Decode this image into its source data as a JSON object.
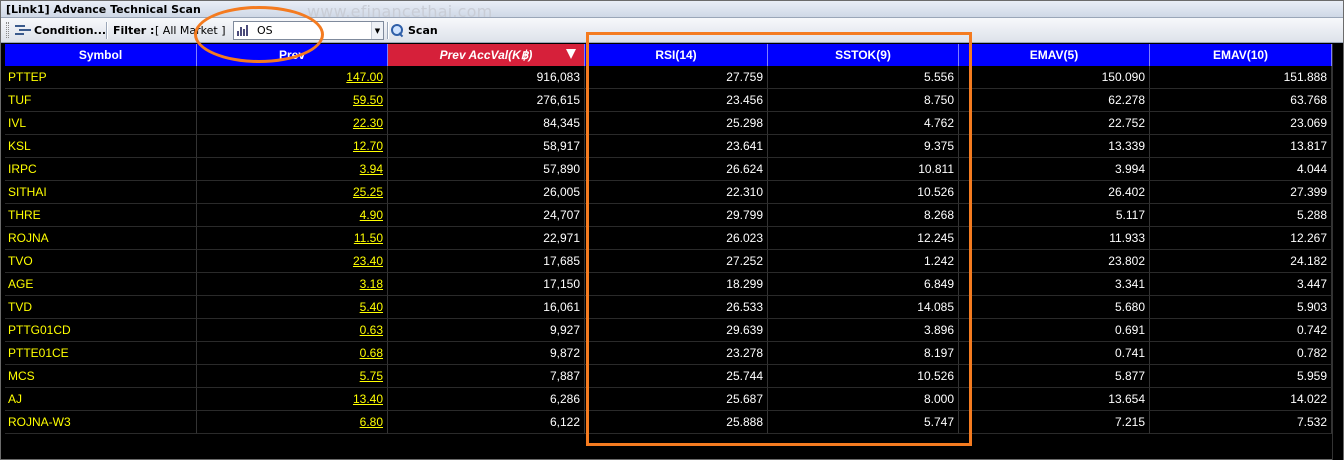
{
  "window": {
    "title": "[Link1] Advance Technical Scan",
    "watermark": "www.efinancethai.com"
  },
  "toolbar": {
    "condition_label": "Condition...",
    "filter_label": "Filter :",
    "filter_value": "[ All Market ]",
    "combo_value": "OS",
    "scan_label": "Scan"
  },
  "columns": [
    "Symbol",
    "Prev",
    "Prev AccVal(K฿)",
    "RSI(14)",
    "SSTOK(9)",
    "EMAV(5)",
    "EMAV(10)"
  ],
  "sorted_column": "Prev AccVal(K฿)",
  "rows": [
    [
      "PTTEP",
      "147.00",
      "916,083",
      "27.759",
      "5.556",
      "150.090",
      "151.888"
    ],
    [
      "TUF",
      "59.50",
      "276,615",
      "23.456",
      "8.750",
      "62.278",
      "63.768"
    ],
    [
      "IVL",
      "22.30",
      "84,345",
      "25.298",
      "4.762",
      "22.752",
      "23.069"
    ],
    [
      "KSL",
      "12.70",
      "58,917",
      "23.641",
      "9.375",
      "13.339",
      "13.817"
    ],
    [
      "IRPC",
      "3.94",
      "57,890",
      "26.624",
      "10.811",
      "3.994",
      "4.044"
    ],
    [
      "SITHAI",
      "25.25",
      "26,005",
      "22.310",
      "10.526",
      "26.402",
      "27.399"
    ],
    [
      "THRE",
      "4.90",
      "24,707",
      "29.799",
      "8.268",
      "5.117",
      "5.288"
    ],
    [
      "ROJNA",
      "11.50",
      "22,971",
      "26.023",
      "12.245",
      "11.933",
      "12.267"
    ],
    [
      "TVO",
      "23.40",
      "17,685",
      "27.252",
      "1.242",
      "23.802",
      "24.182"
    ],
    [
      "AGE",
      "3.18",
      "17,150",
      "18.299",
      "6.849",
      "3.341",
      "3.447"
    ],
    [
      "TVD",
      "5.40",
      "16,061",
      "26.533",
      "14.085",
      "5.680",
      "5.903"
    ],
    [
      "PTTG01CD",
      "0.63",
      "9,927",
      "29.639",
      "3.896",
      "0.691",
      "0.742"
    ],
    [
      "PTTE01CE",
      "0.68",
      "9,872",
      "23.278",
      "8.197",
      "0.741",
      "0.782"
    ],
    [
      "MCS",
      "5.75",
      "7,887",
      "25.744",
      "10.526",
      "5.877",
      "5.959"
    ],
    [
      "AJ",
      "13.40",
      "6,286",
      "25.687",
      "8.000",
      "13.654",
      "14.022"
    ],
    [
      "ROJNA-W3",
      "6.80",
      "6,122",
      "25.888",
      "5.747",
      "7.215",
      "7.532"
    ]
  ],
  "colors": {
    "header_bg": "#0000ff",
    "sorted_header_bg": "#d6203a",
    "symbol_text": "#ffff00",
    "highlight": "#f47b20",
    "grid_bg": "#000000"
  }
}
